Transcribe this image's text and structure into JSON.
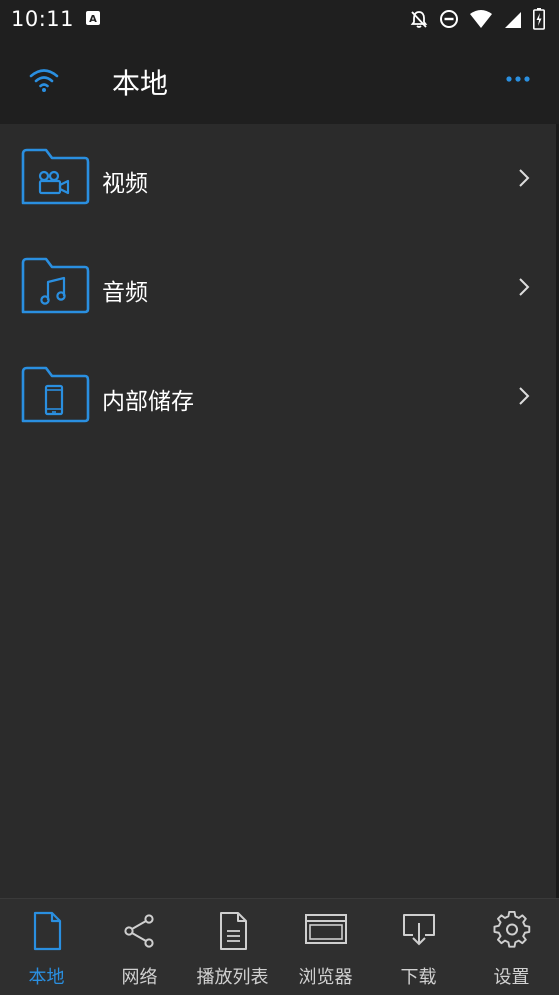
{
  "status_bar": {
    "time": "10:11",
    "icons": [
      "notification-a-icon",
      "bell-off-icon",
      "dnd-icon",
      "wifi-signal-icon",
      "cell-signal-icon",
      "battery-icon"
    ]
  },
  "header": {
    "title": "本地",
    "left_icon": "wifi-icon",
    "right_icon": "more-dots-icon"
  },
  "list": [
    {
      "label": "视频",
      "icon": "video-camera-folder-icon"
    },
    {
      "label": "音频",
      "icon": "music-note-folder-icon"
    },
    {
      "label": "内部储存",
      "icon": "phone-folder-icon"
    }
  ],
  "bottom_nav": [
    {
      "label": "本地",
      "icon": "file-icon",
      "active": true
    },
    {
      "label": "网络",
      "icon": "share-icon",
      "active": false
    },
    {
      "label": "播放列表",
      "icon": "playlist-doc-icon",
      "active": false
    },
    {
      "label": "浏览器",
      "icon": "browser-window-icon",
      "active": false
    },
    {
      "label": "下载",
      "icon": "download-icon",
      "active": false
    },
    {
      "label": "设置",
      "icon": "gear-icon",
      "active": false
    }
  ],
  "colors": {
    "accent": "#2a8fe0",
    "background": "#2b2b2b",
    "bar": "#1f1f1f",
    "text": "#ffffff",
    "nav_inactive": "#d0d0d0"
  }
}
